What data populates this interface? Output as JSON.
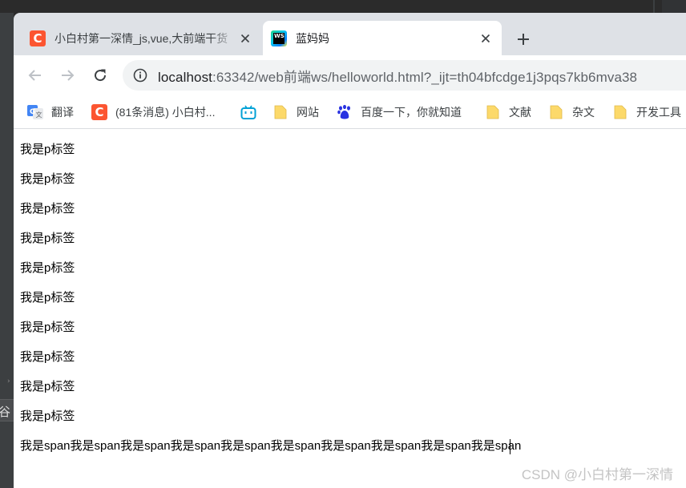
{
  "ide": {
    "side_strip_text": "谷"
  },
  "tabs": [
    {
      "title": "小白村第一深情_js,vue,大前端干货",
      "icon": "csdn-logo-icon",
      "icon_text": "C",
      "active": false
    },
    {
      "title": "蓝妈妈",
      "icon": "webstorm-icon",
      "icon_text": "WS",
      "active": true
    }
  ],
  "toolbar": {
    "url_host": "localhost",
    "url_path": ":63342/web前端ws/helloworld.html?_ijt=th04bfcdge1j3pqs7kb6mva38",
    "icons": [
      "back-icon",
      "forward-icon",
      "reload-icon",
      "site-info-icon"
    ]
  },
  "bookmarks": [
    {
      "label": "翻译",
      "icon": "google-translate-icon"
    },
    {
      "label": "(81条消息) 小白村...",
      "icon": "csdn-logo-icon",
      "icon_text": "C"
    },
    {
      "label": "",
      "icon": "bilibili-icon"
    },
    {
      "label": "网站",
      "icon": "folder-icon"
    },
    {
      "label": "百度一下，你就知道",
      "icon": "baidu-icon"
    },
    {
      "label": "文献",
      "icon": "folder-icon"
    },
    {
      "label": "杂文",
      "icon": "folder-icon"
    },
    {
      "label": "开发工具",
      "icon": "folder-icon"
    }
  ],
  "page": {
    "paragraphs": [
      "我是p标签",
      "我是p标签",
      "我是p标签",
      "我是p标签",
      "我是p标签",
      "我是p标签",
      "我是p标签",
      "我是p标签",
      "我是p标签",
      "我是p标签"
    ],
    "spans": [
      "我是span",
      "我是span",
      "我是span",
      "我是span",
      "我是span",
      "我是span",
      "我是span",
      "我是span",
      "我是span",
      "我是span"
    ]
  },
  "watermark": "CSDN @小白村第一深情",
  "colors": {
    "csdn_brand": "#fc5531",
    "tab_strip": "#dee1e6",
    "omnibox": "#f1f3f4",
    "folder": "#fcd96a"
  }
}
